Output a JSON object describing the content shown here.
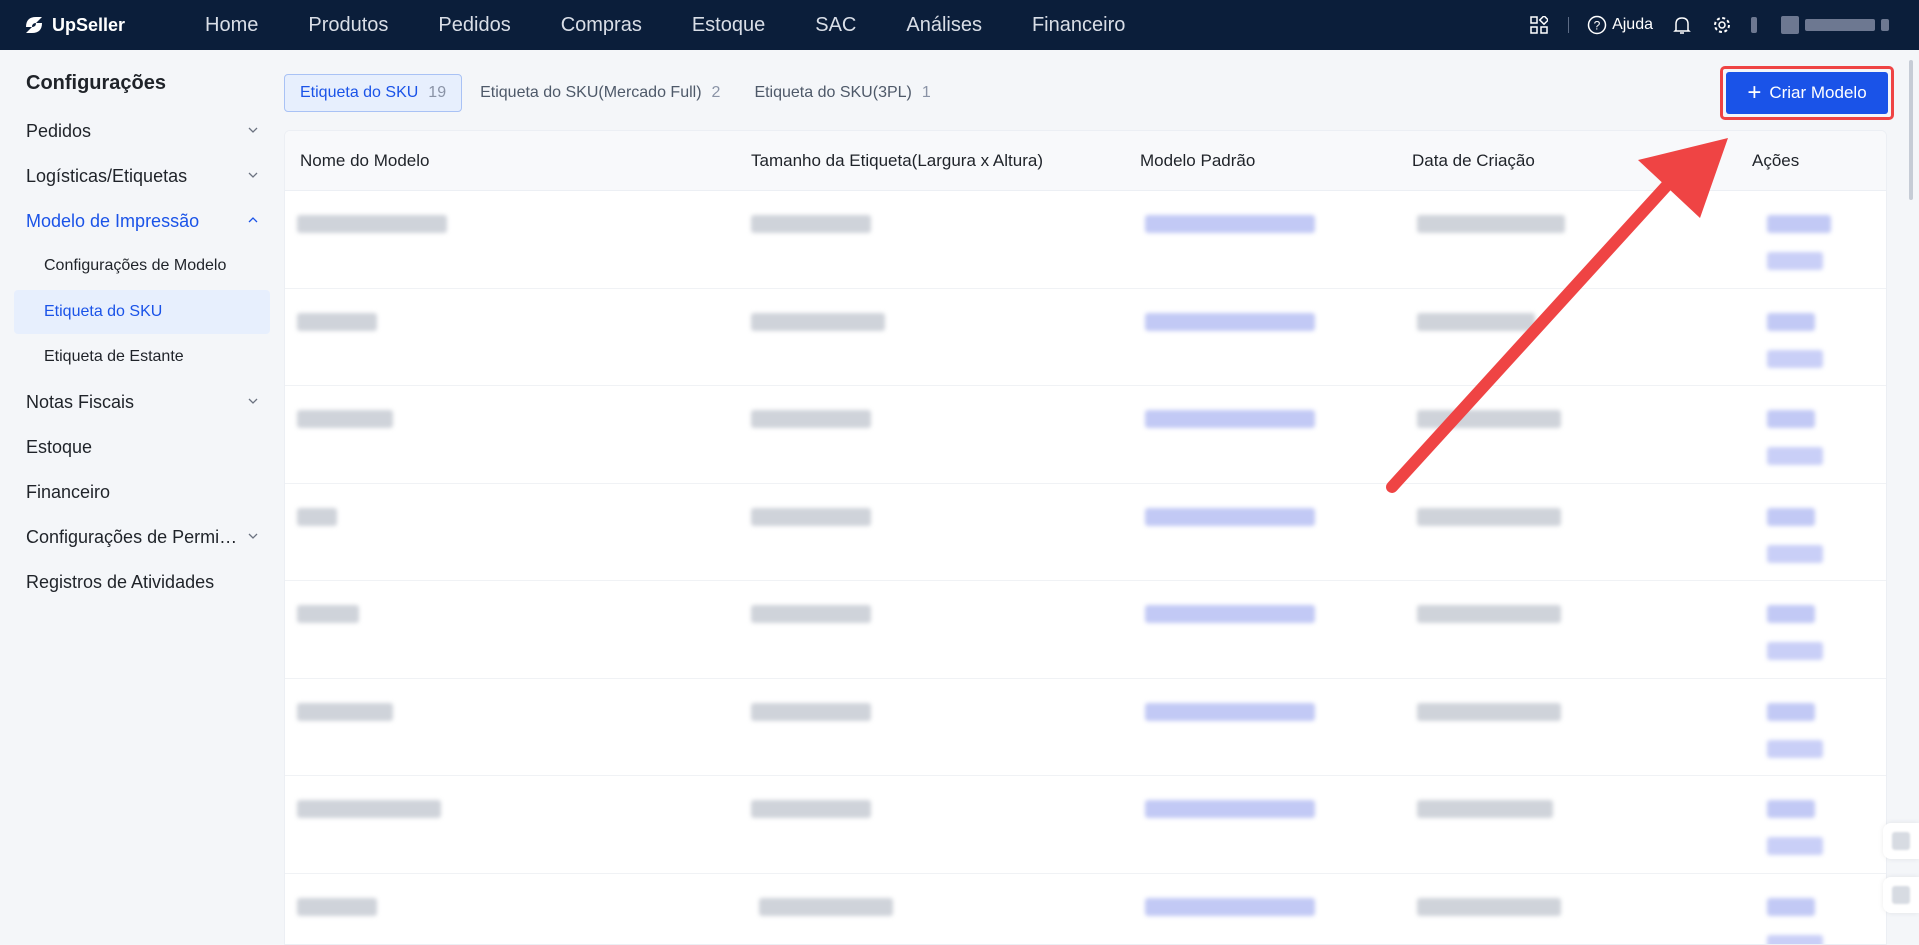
{
  "app": {
    "logo_text": "UpSeller"
  },
  "nav": {
    "items": [
      "Home",
      "Produtos",
      "Pedidos",
      "Compras",
      "Estoque",
      "SAC",
      "Análises",
      "Financeiro"
    ],
    "help_label": "Ajuda"
  },
  "sidebar": {
    "title": "Configurações",
    "items": [
      {
        "label": "Pedidos",
        "chevron": "down"
      },
      {
        "label": "Logísticas/Etiquetas",
        "chevron": "down"
      },
      {
        "label": "Modelo de Impressão",
        "chevron": "up"
      },
      {
        "label": "Configurações de Modelo"
      },
      {
        "label": "Etiqueta do SKU"
      },
      {
        "label": "Etiqueta de Estante"
      },
      {
        "label": "Notas Fiscais",
        "chevron": "down"
      },
      {
        "label": "Estoque"
      },
      {
        "label": "Financeiro"
      },
      {
        "label": "Configurações de Permi…",
        "chevron": "down"
      },
      {
        "label": "Registros de Atividades"
      }
    ]
  },
  "tabs": [
    {
      "label": "Etiqueta do SKU",
      "count": "19"
    },
    {
      "label": "Etiqueta do SKU(Mercado Full)",
      "count": "2"
    },
    {
      "label": "Etiqueta do SKU(3PL)",
      "count": "1"
    }
  ],
  "create_button": {
    "label": "Criar Modelo"
  },
  "table": {
    "headers": [
      "Nome do Modelo",
      "Tamanho da Etiqueta(Largura x Altura)",
      "Modelo Padrão",
      "Data de Criação",
      "Ações"
    ]
  },
  "colors": {
    "nav_bg": "#0b1e3a",
    "accent": "#1a53e8",
    "highlight": "#ef4444"
  },
  "icons": [
    "apps-icon",
    "help-circle-icon",
    "bell-icon",
    "gear-icon",
    "plus-icon",
    "chevron-down-icon",
    "chevron-up-icon"
  ]
}
